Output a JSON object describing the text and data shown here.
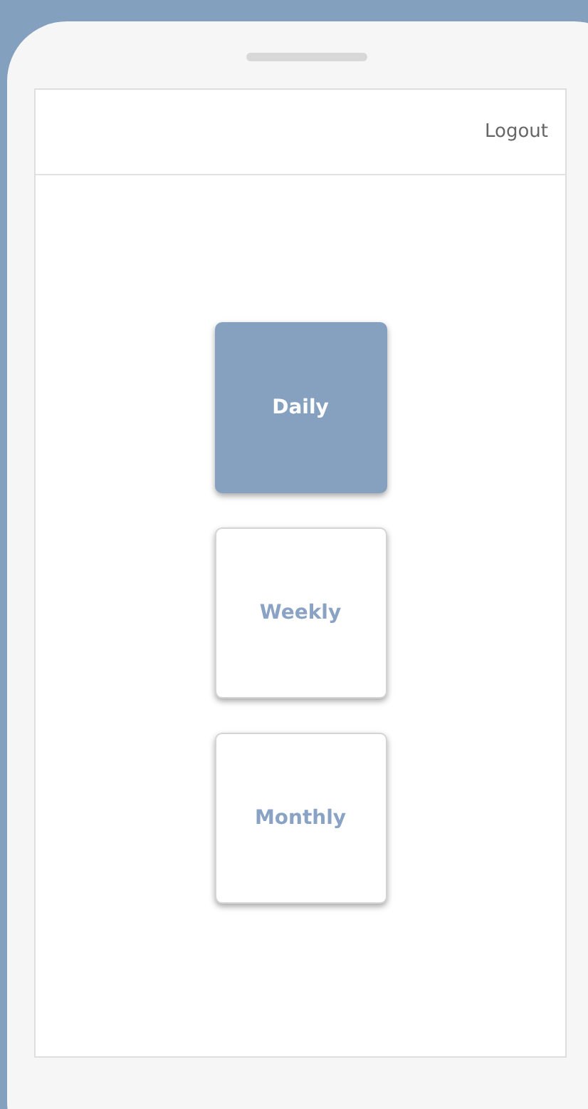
{
  "header": {
    "logout": "Logout"
  },
  "options": [
    {
      "label": "Daily",
      "selected": true
    },
    {
      "label": "Weekly",
      "selected": false
    },
    {
      "label": "Monthly",
      "selected": false
    }
  ]
}
